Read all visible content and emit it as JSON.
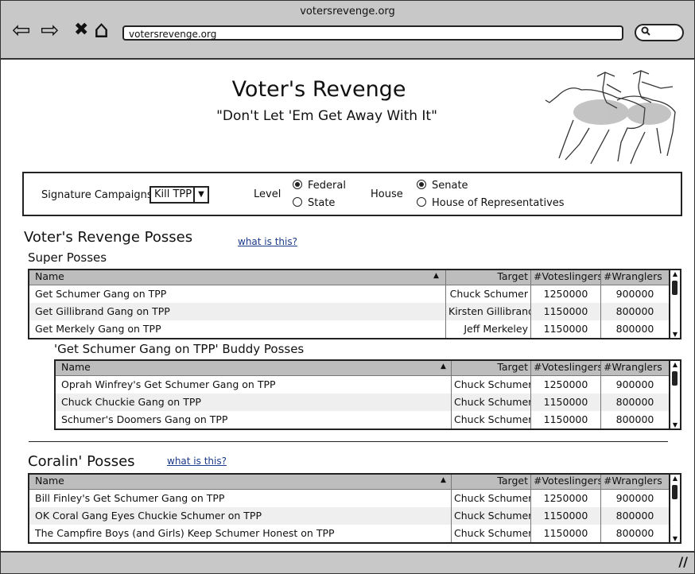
{
  "browser": {
    "window_title": "votersrevenge.org",
    "url": "votersrevenge.org",
    "back": "⇦",
    "forward": "⇨",
    "stop": "✖",
    "home": "⌂",
    "search_icon": "search-icon"
  },
  "page": {
    "title": "Voter's Revenge",
    "subtitle": "\"Don't Let 'Em Get Away With It\""
  },
  "controls": {
    "signature_label": "Signature Campaigns:",
    "campaign_value": "Kill TPP",
    "level_label": "Level",
    "level_options": [
      "Federal",
      "State"
    ],
    "level_selected": "Federal",
    "house_label": "House",
    "house_options": [
      "Senate",
      "House of Representatives"
    ],
    "house_selected": "Senate"
  },
  "posses": {
    "heading": "Voter's Revenge Posses",
    "what_link": "what is this?",
    "super_heading": "Super Posses",
    "columns": [
      "Name",
      "Target",
      "#Voteslingers",
      "#Wranglers"
    ],
    "super_rows": [
      [
        "Get Schumer Gang on TPP",
        "Chuck Schumer",
        "1250000",
        "900000"
      ],
      [
        "Get Gillibrand Gang on TPP",
        "Kirsten Gillibrand",
        "1150000",
        "800000"
      ],
      [
        "Get Merkely Gang on TPP",
        "Jeff Merkeley",
        "1150000",
        "800000"
      ]
    ],
    "buddy_heading": "'Get Schumer Gang on TPP' Buddy Posses",
    "buddy_rows": [
      [
        "Oprah Winfrey's Get Schumer Gang on TPP",
        "Chuck Schumer",
        "1250000",
        "900000"
      ],
      [
        "Chuck Chuckie Gang on TPP",
        "Chuck Schumer",
        "1150000",
        "800000"
      ],
      [
        "Schumer's Doomers Gang on TPP",
        "Chuck Schumer",
        "1150000",
        "800000"
      ]
    ]
  },
  "coralin": {
    "heading": "Coralin' Posses",
    "what_link": "what is this?",
    "rows": [
      [
        "Bill Finley's Get Schumer Gang on TPP",
        "Chuck Schumer",
        "1250000",
        "900000"
      ],
      [
        "OK Coral Gang Eyes Chuckie Schumer on TPP",
        "Chuck Schumer",
        "1150000",
        "800000"
      ],
      [
        "The Campfire Boys (and Girls) Keep Schumer Honest on TPP",
        "Chuck Schumer",
        "1150000",
        "800000"
      ]
    ]
  }
}
